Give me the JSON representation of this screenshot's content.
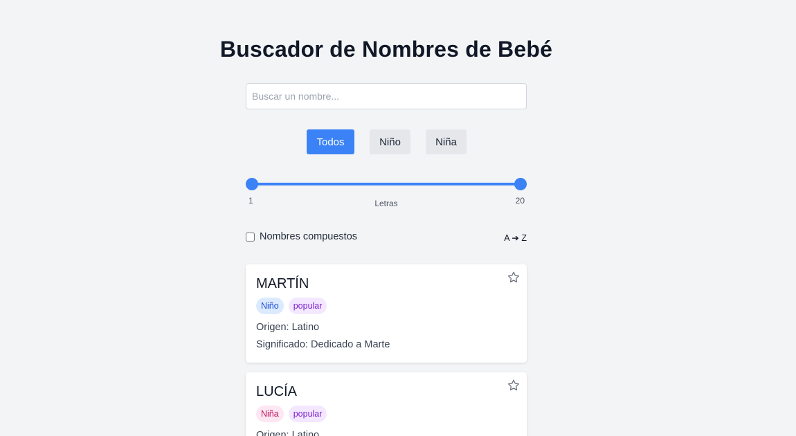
{
  "page": {
    "title": "Buscador de Nombres de Bebé"
  },
  "search": {
    "placeholder": "Buscar un nombre...",
    "value": ""
  },
  "filters": {
    "all": "Todos",
    "boy": "Niño",
    "girl": "Niña",
    "active": "Todos"
  },
  "slider": {
    "min_label": "1",
    "max_label": "20",
    "label": "Letras",
    "low": 1,
    "high": 20
  },
  "options": {
    "compound_label": "Nombres compuestos",
    "compound_checked": false,
    "sort_label": "A ➔ Z"
  },
  "colors": {
    "accent": "#3b82f6",
    "boy_tag_bg": "#dbeafe",
    "girl_tag_bg": "#fce7f3",
    "popular_tag_bg": "#f3e8ff"
  },
  "names": [
    {
      "name": "MARTÍN",
      "gender_tag": "Niño",
      "popular_tag": "popular",
      "origin": "Origen: Latino",
      "meaning": "Significado: Dedicado a Marte",
      "icon": "star-outline-icon"
    },
    {
      "name": "LUCÍA",
      "gender_tag": "Niña",
      "popular_tag": "popular",
      "origin": "Origen: Latino",
      "meaning": "",
      "icon": "star-outline-icon"
    }
  ]
}
